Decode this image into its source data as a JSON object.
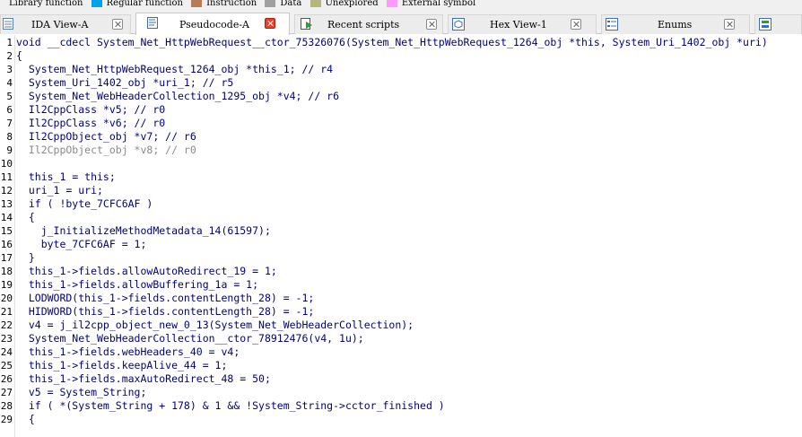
{
  "legend": {
    "items": [
      {
        "label": "Library function",
        "color": "#00ffff"
      },
      {
        "label": "Regular function",
        "color": "#00a2e8"
      },
      {
        "label": "Instruction",
        "color": "#b97a57"
      },
      {
        "label": "Data",
        "color": "#a0a0a0"
      },
      {
        "label": "Unexplored",
        "color": "#b5b57d"
      },
      {
        "label": "External symbol",
        "color": "#ff99ff"
      }
    ]
  },
  "tabs": [
    {
      "label": "IDA View-A",
      "icon": "list-icon",
      "active": false
    },
    {
      "label": "Pseudocode-A",
      "icon": "pseudocode-icon",
      "active": true
    },
    {
      "label": "Recent scripts",
      "icon": "script-icon",
      "active": false
    },
    {
      "label": "Hex View-1",
      "icon": "hex-icon",
      "active": false
    },
    {
      "label": "Enums",
      "icon": "enums-icon",
      "active": false
    },
    {
      "label": "",
      "icon": "structures-icon",
      "active": false
    }
  ],
  "code": {
    "lines": [
      {
        "n": "1",
        "text": "void __cdecl System_Net_HttpWebRequest__ctor_75326076(System_Net_HttpWebRequest_1264_obj *this, System_Uri_1402_obj *uri)"
      },
      {
        "n": "2",
        "text": "{"
      },
      {
        "n": "3",
        "text": "  System_Net_HttpWebRequest_1264_obj *this_1; // r4"
      },
      {
        "n": "4",
        "text": "  System_Uri_1402_obj *uri_1; // r5"
      },
      {
        "n": "5",
        "text": "  System_Net_WebHeaderCollection_1295_obj *v4; // r6"
      },
      {
        "n": "6",
        "text": "  Il2CppClass *v5; // r0"
      },
      {
        "n": "7",
        "text": "  Il2CppClass *v6; // r0"
      },
      {
        "n": "8",
        "text": "  Il2CppObject_obj *v7; // r6"
      },
      {
        "n": "9",
        "text": "  Il2CppObject_obj *v8; // r0"
      },
      {
        "n": "10",
        "text": ""
      },
      {
        "n": "11",
        "text": "  this_1 = this;"
      },
      {
        "n": "12",
        "text": "  uri_1 = uri;"
      },
      {
        "n": "13",
        "text": "  if ( !byte_7CFC6AF )"
      },
      {
        "n": "14",
        "text": "  {"
      },
      {
        "n": "15",
        "text": "    j_InitializeMethodMetadata_14(61597);"
      },
      {
        "n": "16",
        "text": "    byte_7CFC6AF = 1;"
      },
      {
        "n": "17",
        "text": "  }"
      },
      {
        "n": "18",
        "text": "  this_1->fields.allowAutoRedirect_19 = 1;"
      },
      {
        "n": "19",
        "text": "  this_1->fields.allowBuffering_1a = 1;"
      },
      {
        "n": "20",
        "text": "  LODWORD(this_1->fields.contentLength_28) = -1;"
      },
      {
        "n": "21",
        "text": "  HIDWORD(this_1->fields.contentLength_28) = -1;"
      },
      {
        "n": "22",
        "text": "  v4 = j_il2cpp_object_new_0_13(System_Net_WebHeaderCollection);"
      },
      {
        "n": "23",
        "text": "  System_Net_WebHeaderCollection__ctor_78912476(v4, 1u);"
      },
      {
        "n": "24",
        "text": "  this_1->fields.webHeaders_40 = v4;"
      },
      {
        "n": "25",
        "text": "  this_1->fields.keepAlive_44 = 1;"
      },
      {
        "n": "26",
        "text": "  this_1->fields.maxAutoRedirect_48 = 50;"
      },
      {
        "n": "27",
        "text": "  v5 = System_String;"
      },
      {
        "n": "28",
        "text": "  if ( *(System_String + 178) & 1 && !System_String->cctor_finished )"
      },
      {
        "n": "29",
        "text": "  {"
      }
    ]
  }
}
